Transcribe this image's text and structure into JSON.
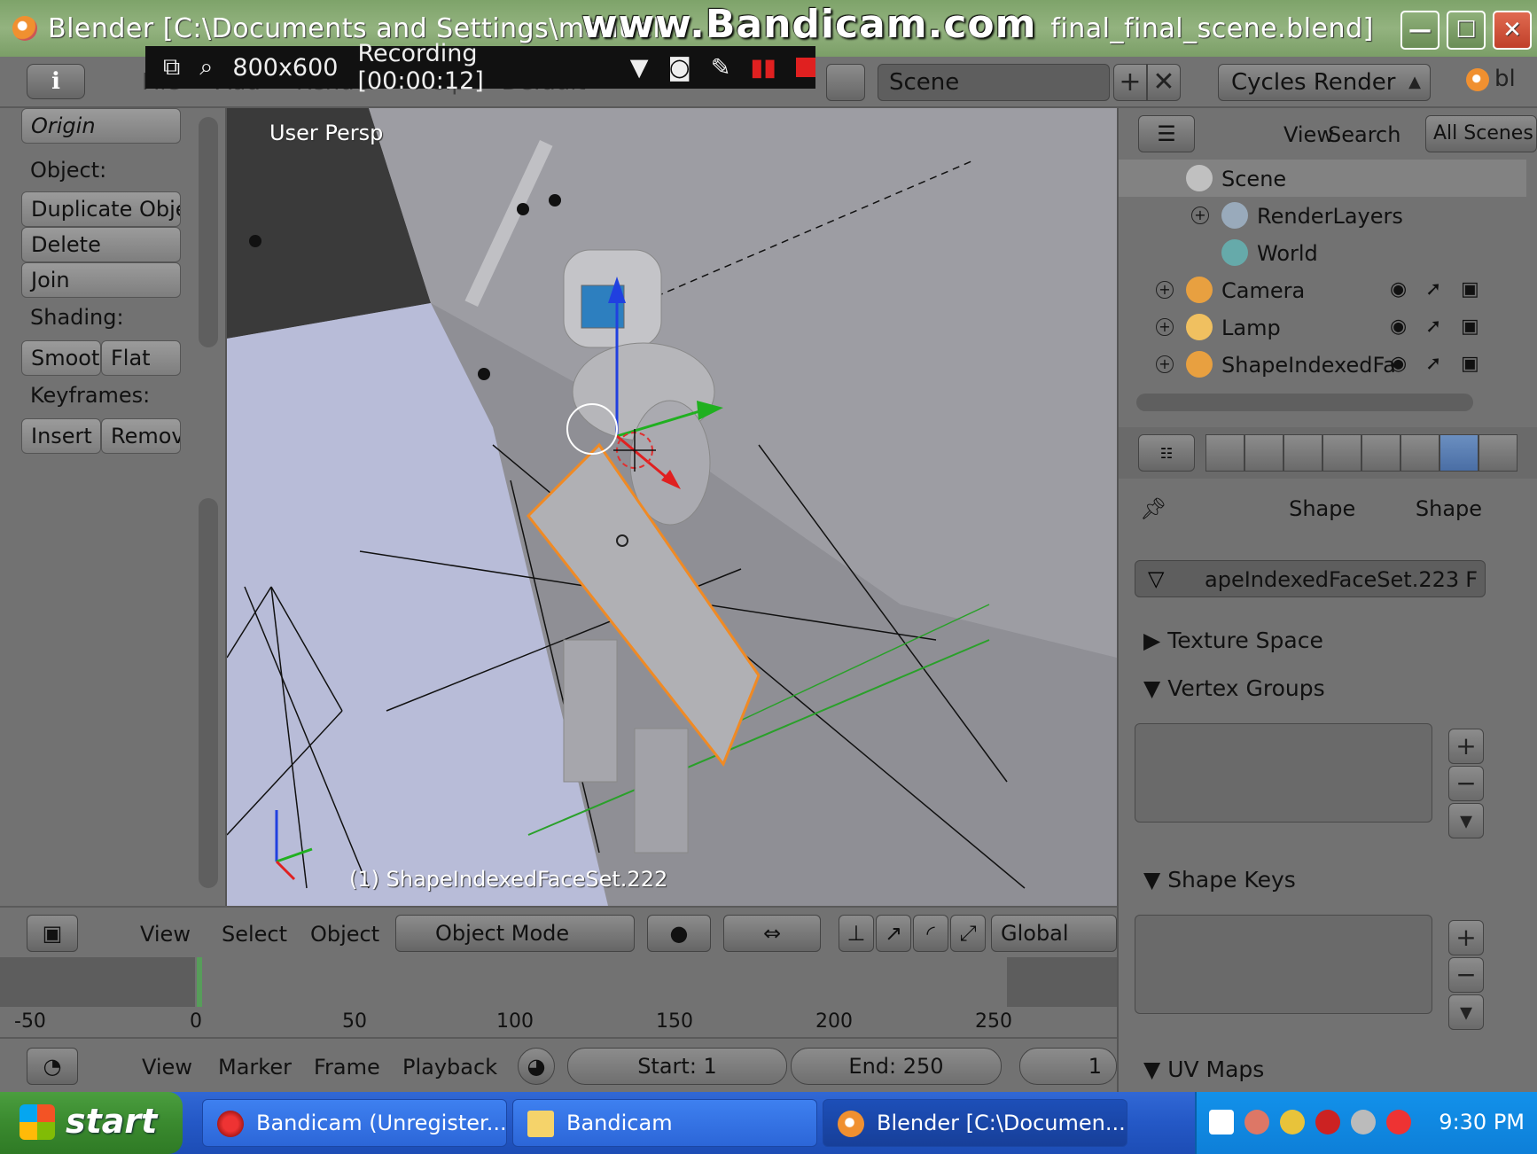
{
  "window": {
    "title": "Blender [C:\\Documents and Settings\\manuel",
    "title_suffix": "final_final_scene.blend]",
    "minimize": "—",
    "maximize": "☐",
    "close": "✕"
  },
  "watermark": "www.Bandicam.com",
  "recording": {
    "size": "800x600",
    "status": "Recording [00:00:12]"
  },
  "header": {
    "menus": [
      "File",
      "Add",
      "Render",
      "Help"
    ],
    "layout": "Default",
    "scene": "Scene",
    "render_engine": "Cycles Render",
    "logo_text": "bl"
  },
  "toolshelf": {
    "origin_label": "Origin",
    "object_heading": "Object:",
    "duplicate_label": "Duplicate Obje",
    "delete_label": "Delete",
    "join_label": "Join",
    "shading_heading": "Shading:",
    "smooth_label": "Smoot",
    "flat_label": "Flat",
    "keyframes_heading": "Keyframes:",
    "insert_label": "Insert",
    "remove_label": "Remov"
  },
  "viewport": {
    "view_label": "User Persp",
    "active_object": "(1) ShapeIndexedFaceSet.222"
  },
  "viewport_header": {
    "view": "View",
    "select": "Select",
    "object": "Object",
    "mode": "Object Mode",
    "orientation": "Global"
  },
  "timeline": {
    "ticks": [
      "-50",
      "0",
      "50",
      "100",
      "150",
      "200",
      "250"
    ],
    "view": "View",
    "marker": "Marker",
    "frame": "Frame",
    "playback": "Playback",
    "start": "Start: 1",
    "end": "End: 250",
    "current": "1"
  },
  "outliner": {
    "view": "View",
    "search": "Search",
    "filter": "All Scenes",
    "items": [
      {
        "label": "Scene"
      },
      {
        "label": "RenderLayers"
      },
      {
        "label": "World"
      },
      {
        "label": "Camera"
      },
      {
        "label": "Lamp"
      },
      {
        "label": "ShapeIndexedFa"
      }
    ]
  },
  "properties": {
    "breadcrumb_object": "Shape",
    "breadcrumb_data": "Shape",
    "mesh_name": "apeIndexedFaceSet.223",
    "fake_user": "F",
    "panels": {
      "texture_space": "Texture Space",
      "vertex_groups": "Vertex Groups",
      "shape_keys": "Shape Keys",
      "uv_maps": "UV Maps"
    }
  },
  "taskbar": {
    "start": "start",
    "tasks": [
      {
        "label": "Bandicam (Unregister..."
      },
      {
        "label": "Bandicam"
      },
      {
        "label": "Blender [C:\\Documen..."
      }
    ],
    "clock": "9:30 PM"
  },
  "colors": {
    "blender_panel": "#727272",
    "viewport_bg": "#8f8f95",
    "xp_taskbar": "#2458c6",
    "xp_start": "#3a8a2f"
  }
}
